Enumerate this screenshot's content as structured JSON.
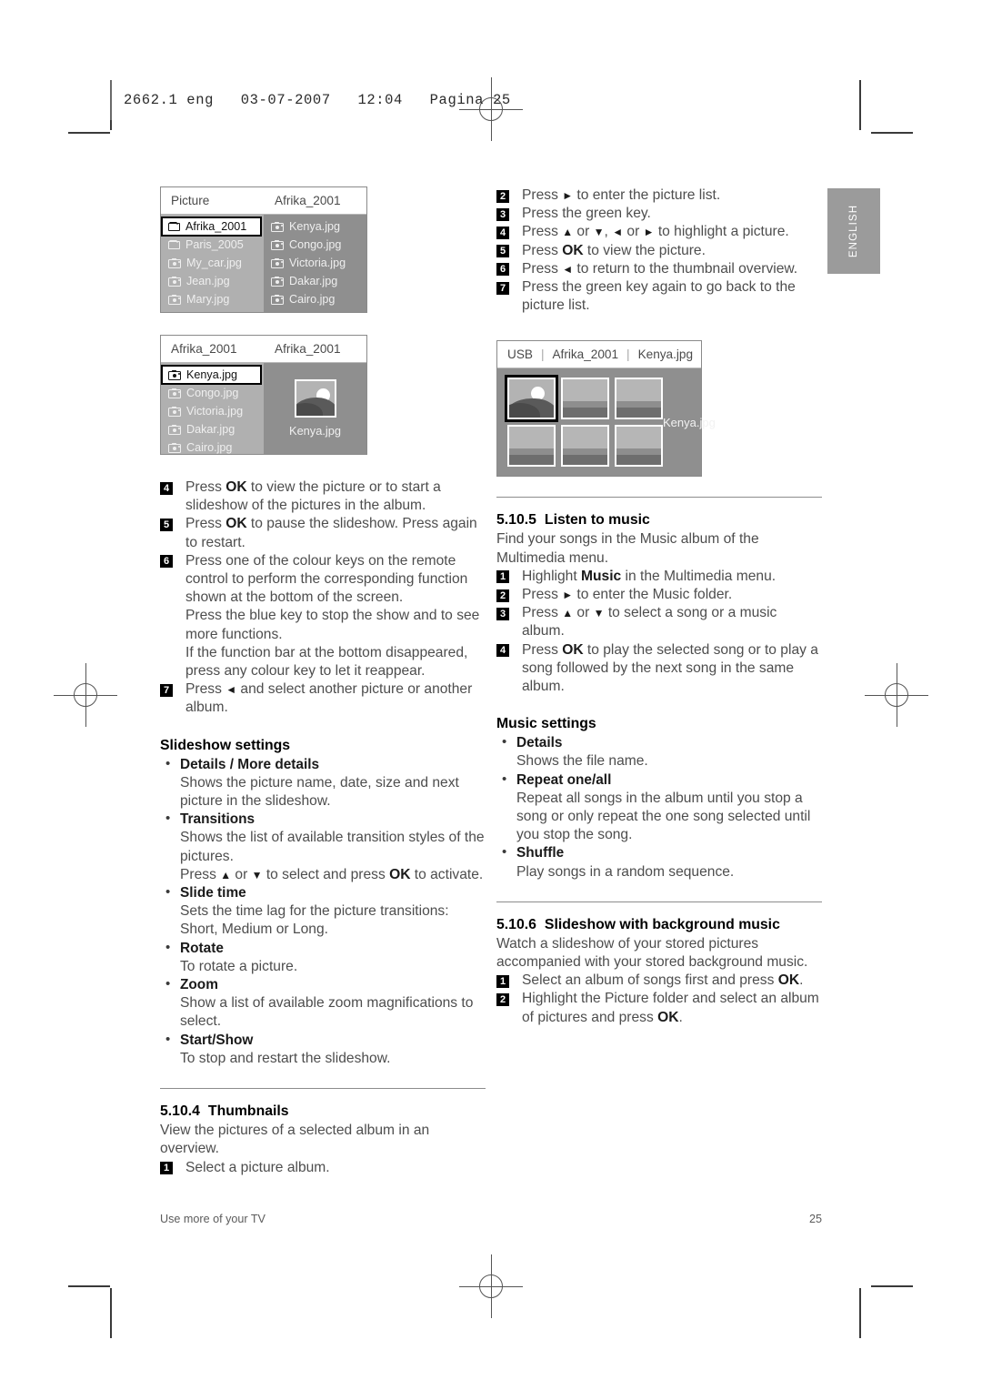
{
  "print": {
    "slug": "2662.1 eng   03-07-2007   12:04   Pagina 25",
    "side_tab": "ENGLISH"
  },
  "footer": {
    "left": "Use more of your TV",
    "page_number": "25"
  },
  "screenshots": {
    "picture_browser": {
      "name": "picture-album-browser",
      "header_left": "Picture",
      "header_right": "Afrika_2001",
      "left_items": [
        {
          "icon": "folder-icon",
          "label": "Afrika_2001",
          "selected": true
        },
        {
          "icon": "folder-icon",
          "label": "Paris_2005",
          "selected": false
        },
        {
          "icon": "camera-icon",
          "label": "My_car.jpg",
          "selected": false
        },
        {
          "icon": "camera-icon",
          "label": "Jean.jpg",
          "selected": false
        },
        {
          "icon": "camera-icon",
          "label": "Mary.jpg",
          "selected": false
        }
      ],
      "right_items": [
        {
          "icon": "camera-icon",
          "label": "Kenya.jpg"
        },
        {
          "icon": "camera-icon",
          "label": "Congo.jpg"
        },
        {
          "icon": "camera-icon",
          "label": "Victoria.jpg"
        },
        {
          "icon": "camera-icon",
          "label": "Dakar.jpg"
        },
        {
          "icon": "camera-icon",
          "label": "Cairo.jpg"
        }
      ]
    },
    "picture_preview": {
      "name": "picture-preview-browser",
      "header_left": "Afrika_2001",
      "header_right": "Afrika_2001",
      "left_items": [
        {
          "icon": "camera-icon",
          "label": "Kenya.jpg",
          "selected": true
        },
        {
          "icon": "camera-icon",
          "label": "Congo.jpg",
          "selected": false
        },
        {
          "icon": "camera-icon",
          "label": "Victoria.jpg",
          "selected": false
        },
        {
          "icon": "camera-icon",
          "label": "Dakar.jpg",
          "selected": false
        },
        {
          "icon": "camera-icon",
          "label": "Cairo.jpg",
          "selected": false
        }
      ],
      "preview_caption": "Kenya.jpg"
    },
    "thumbnail_overview": {
      "name": "thumbnail-overview",
      "breadcrumb": [
        "USB",
        "Afrika_2001",
        "Kenya.jpg"
      ],
      "selected_caption": "Kenya.jpg",
      "tile_count": 6,
      "selected_tile_index": 0
    }
  },
  "left_column": {
    "steps": [
      {
        "num": "4",
        "parts": [
          {
            "t": "Press ",
            "b": false
          },
          {
            "t": "OK",
            "b": true
          },
          {
            "t": " to view the picture or to start a slideshow of the pictures in the album.",
            "b": false
          }
        ]
      },
      {
        "num": "5",
        "parts": [
          {
            "t": "Press ",
            "b": false
          },
          {
            "t": "OK",
            "b": true
          },
          {
            "t": " to pause the slideshow. Press again to restart.",
            "b": false
          }
        ]
      },
      {
        "num": "6",
        "parts": [
          {
            "t": "Press one of the colour keys on the remote control to perform the corresponding function shown at the bottom of the screen.",
            "b": false
          },
          {
            "t": "\n",
            "b": false
          },
          {
            "t": "Press the blue key to stop the show and to see more functions.",
            "b": false
          },
          {
            "t": "\n",
            "b": false
          },
          {
            "t": "If the function bar at the bottom disappeared, press any colour key to let it reappear.",
            "b": false
          }
        ]
      },
      {
        "num": "7",
        "parts": [
          {
            "t": "Press ",
            "b": false
          },
          {
            "t": "◄",
            "b": false,
            "arrow": true
          },
          {
            "t": " and select another picture or another album.",
            "b": false
          }
        ]
      }
    ],
    "slideshow_settings": {
      "heading": "Slideshow settings",
      "items": [
        {
          "title": "Details / More details",
          "desc": "Shows the picture name, date, size and next picture in the slideshow."
        },
        {
          "title": "Transitions",
          "desc": "Shows the list of available transition styles of the pictures.\nPress ▲ or ▼ to select and press OK to activate."
        },
        {
          "title": "Slide time",
          "desc": "Sets the time lag for the picture transitions: Short, Medium or Long."
        },
        {
          "title": "Rotate",
          "desc": "To rotate a picture."
        },
        {
          "title": "Zoom",
          "desc": "Show a list of available zoom magnifications to select."
        },
        {
          "title": "Start/Show",
          "desc": "To stop and restart the slideshow."
        }
      ]
    },
    "thumbnails_section": {
      "number": "5.10.4",
      "heading": "Thumbnails",
      "intro": "View the pictures of a selected album in an overview.",
      "steps": [
        {
          "num": "1",
          "text": "Select a picture album."
        }
      ]
    }
  },
  "right_column": {
    "steps": [
      {
        "num": "2",
        "text": "Press ► to enter the picture list."
      },
      {
        "num": "3",
        "text": "Press the green key."
      },
      {
        "num": "4",
        "text": "Press ▲ or ▼, ◄ or ► to highlight a picture."
      },
      {
        "num": "5",
        "text": "Press OK to view the picture."
      },
      {
        "num": "6",
        "text": "Press ◄ to return to the thumbnail overview."
      },
      {
        "num": "7",
        "text": "Press the green key again to go back to the picture list."
      }
    ],
    "listen_to_music": {
      "number": "5.10.5",
      "heading": "Listen to music",
      "intro": "Find your songs in the Music album of the Multimedia menu.",
      "steps": [
        {
          "num": "1",
          "text": "Highlight Music in the Multimedia menu."
        },
        {
          "num": "2",
          "text": "Press ► to enter the Music folder."
        },
        {
          "num": "3",
          "text": "Press ▲ or ▼ to select a song or a music album."
        },
        {
          "num": "4",
          "text": "Press OK to play the selected song or to play a song followed by the next song in the same album."
        }
      ]
    },
    "music_settings": {
      "heading": "Music settings",
      "items": [
        {
          "title": "Details",
          "desc": "Shows the file name."
        },
        {
          "title": "Repeat one/all",
          "desc": "Repeat all songs in the album until you stop a song or only repeat the one song selected until you stop the song."
        },
        {
          "title": "Shuffle",
          "desc": "Play songs in a random sequence."
        }
      ]
    },
    "slideshow_music": {
      "number": "5.10.6",
      "heading": "Slideshow with background music",
      "intro": "Watch a slideshow of your stored pictures accompanied with your stored background music.",
      "steps": [
        {
          "num": "1",
          "text": "Select an album of songs first and press OK."
        },
        {
          "num": "2",
          "text": "Highlight the Picture folder and select an album of pictures and press OK."
        }
      ]
    }
  },
  "colors": {
    "page_background": "#ffffff",
    "body_text": "#4d4d4d",
    "heading_text": "#000000",
    "tab_gray": "#9b9b9b",
    "ui_pane_light": "#b0b0b0",
    "ui_pane_dark": "#8f8f8f"
  }
}
